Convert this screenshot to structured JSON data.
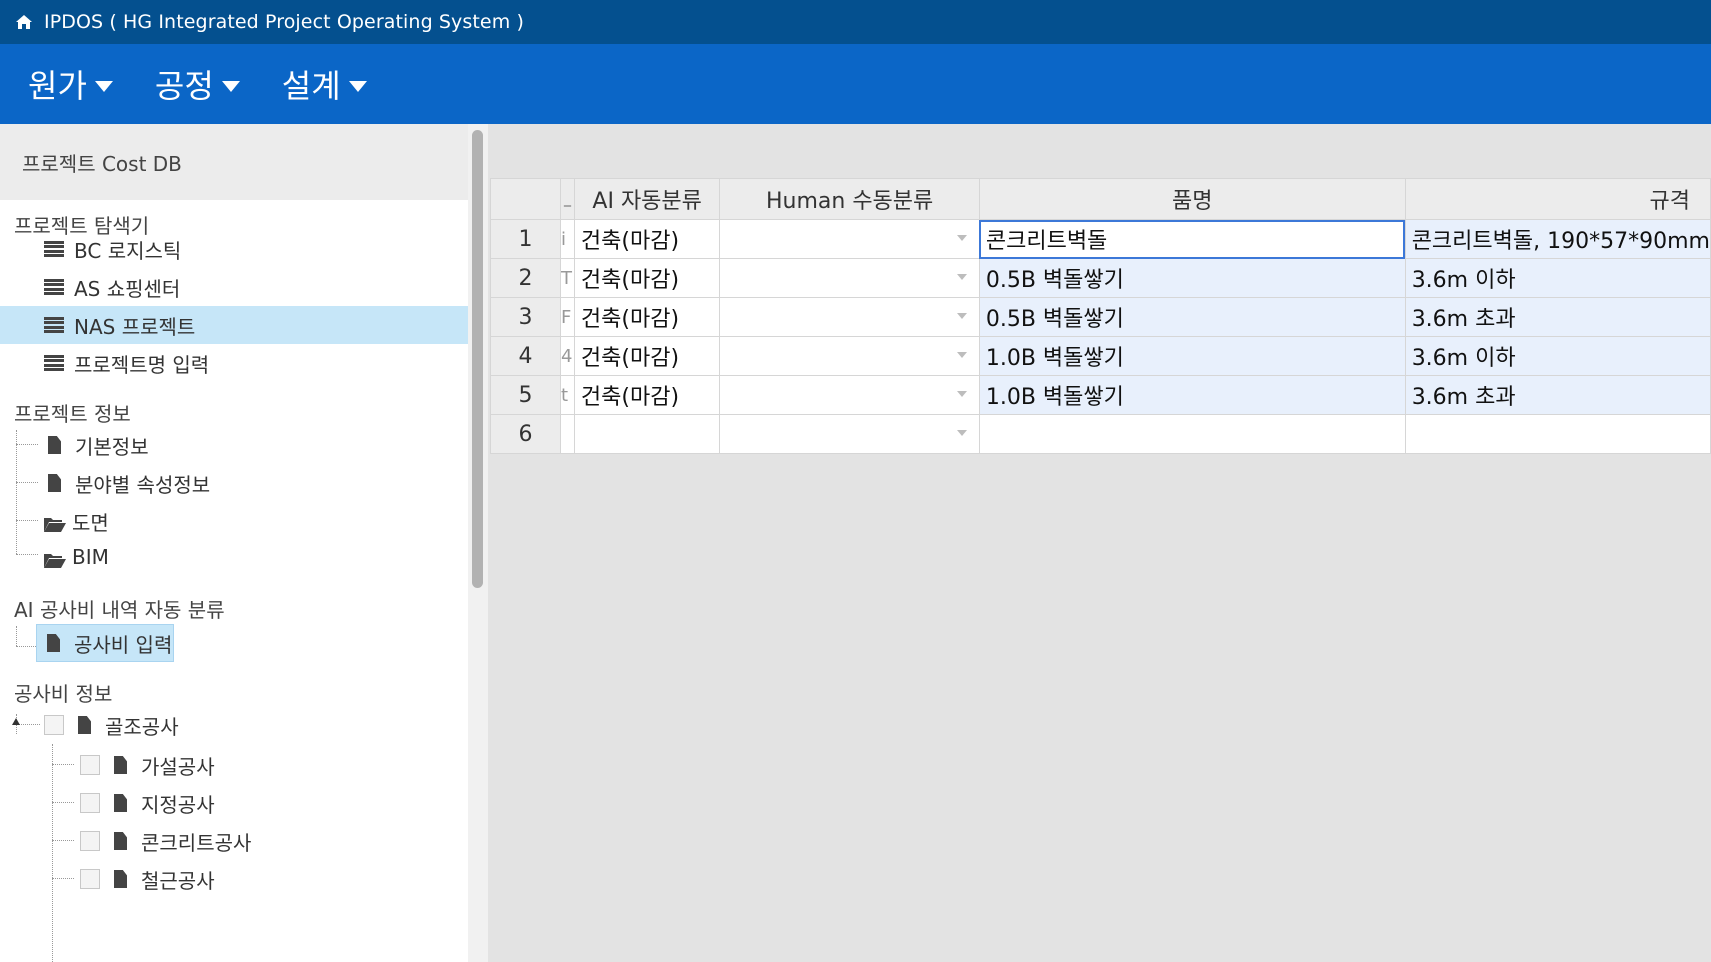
{
  "app": {
    "title": "IPDOS ( HG Integrated Project Operating System )"
  },
  "menu": [
    "원가",
    "공정",
    "설계"
  ],
  "sidebar": {
    "header": "프로젝트 Cost DB",
    "explorer": {
      "title": "프로젝트 탐색기",
      "items": [
        "BC 로지스틱",
        "AS 쇼핑센터",
        "NAS 프로젝트",
        "프로젝트명 입력"
      ],
      "selected": "NAS 프로젝트"
    },
    "info": {
      "title": "프로젝트 정보",
      "items": [
        "기본정보",
        "분야별 속성정보",
        "도면",
        "BIM"
      ]
    },
    "ai": {
      "title": "AI 공사비 내역 자동 분류",
      "items": [
        "공사비 입력"
      ]
    },
    "cost": {
      "title": "공사비 정보",
      "root": "골조공사",
      "children": [
        "가설공사",
        "지정공사",
        "콘크리트공사",
        "철근공사"
      ]
    }
  },
  "grid": {
    "columns": [
      "",
      "_",
      "AI 자동분류",
      "Human 수동분류",
      "품명",
      "규격"
    ],
    "rows": [
      {
        "n": "1",
        "c": "i",
        "ai": "건축(마감)",
        "human": "",
        "name": "콘크리트벽돌",
        "spec": "콘크리트벽돌, 190*57*90mm"
      },
      {
        "n": "2",
        "c": "T",
        "ai": "건축(마감)",
        "human": "",
        "name": "0.5B 벽돌쌓기",
        "spec": "3.6m 이하"
      },
      {
        "n": "3",
        "c": "F",
        "ai": "건축(마감)",
        "human": "",
        "name": "0.5B 벽돌쌓기",
        "spec": "3.6m 초과"
      },
      {
        "n": "4",
        "c": "4",
        "ai": "건축(마감)",
        "human": "",
        "name": "1.0B 벽돌쌓기",
        "spec": "3.6m 이하"
      },
      {
        "n": "5",
        "c": "t",
        "ai": "건축(마감)",
        "human": "",
        "name": "1.0B 벽돌쌓기",
        "spec": "3.6m 초과"
      },
      {
        "n": "6",
        "c": "",
        "ai": "",
        "human": "",
        "name": "",
        "spec": ""
      }
    ]
  },
  "colors": {
    "titlebar": "#04508f",
    "menubar": "#0b66c7",
    "selected": "#c6e6f8",
    "cell_fill": "#e8f0fc"
  }
}
